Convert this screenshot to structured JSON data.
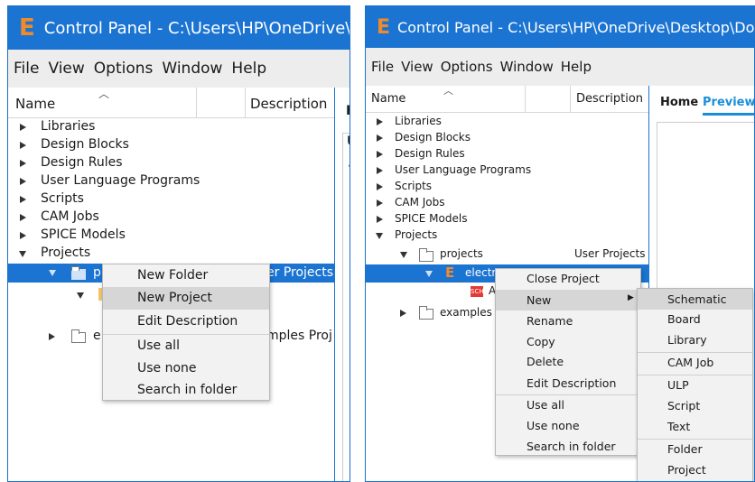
{
  "left": {
    "title": "Control Panel - C:\\Users\\HP\\OneDrive\\De",
    "menu": [
      "File",
      "View",
      "Options",
      "Window",
      "Help"
    ],
    "columns": {
      "name": "Name",
      "description": "Description"
    },
    "tree_items": [
      "Libraries",
      "Design Blocks",
      "Design Rules",
      "User Language Programs",
      "Scripts",
      "CAM Jobs",
      "SPICE Models",
      "Projects"
    ],
    "projects_row": {
      "name": "p",
      "description": "er Projects"
    },
    "examples_row": {
      "name": "e",
      "description": "mples Proj"
    },
    "context_menu": [
      "New Folder",
      "New Project",
      "Edit Description",
      "Use all",
      "Use none",
      "Search in folder"
    ]
  },
  "right": {
    "title": "Control Panel - C:\\Users\\HP\\OneDrive\\Desktop\\Docum",
    "menu": [
      "File",
      "View",
      "Options",
      "Window",
      "Help"
    ],
    "columns": {
      "name": "Name",
      "description": "Description"
    },
    "tree_items": [
      "Libraries",
      "Design Blocks",
      "Design Rules",
      "User Language Programs",
      "Scripts",
      "CAM Jobs",
      "SPICE Models",
      "Projects"
    ],
    "projects_row": {
      "name": "projects",
      "description": "User Projects"
    },
    "electronics_row": {
      "name": "electr"
    },
    "file_row": {
      "name": "A",
      "icon_text": "SCH"
    },
    "examples_row": {
      "name": "examples"
    },
    "tabs": {
      "home": "Home",
      "preview": "Preview"
    },
    "context_menu": [
      "Close Project",
      "New",
      "Rename",
      "Copy",
      "Delete",
      "Edit Description",
      "Use all",
      "Use none",
      "Search in folder"
    ],
    "submenu": [
      "Schematic",
      "Board",
      "Library",
      "CAM Job",
      "ULP",
      "Script",
      "Text",
      "Folder",
      "Project"
    ]
  },
  "colors": {
    "titlebar": "#1b74d2",
    "selection": "#1b74d2",
    "logo": "#f08a2b",
    "preview_tab": "#1a8fd8"
  }
}
